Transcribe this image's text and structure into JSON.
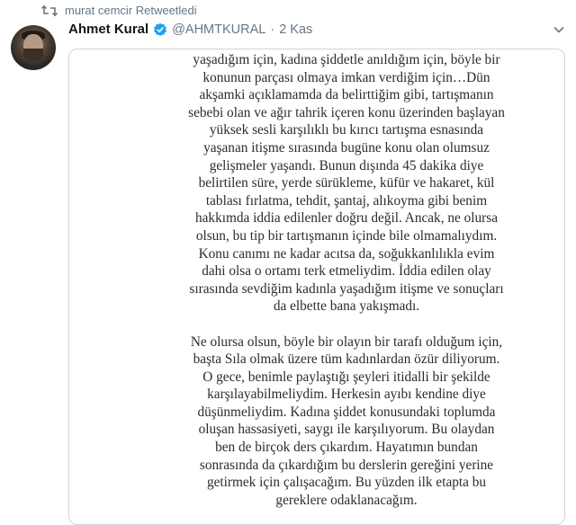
{
  "retweet": {
    "icon": "retweet-icon",
    "text": "murat cemcir Retweetledi"
  },
  "tweet": {
    "display_name": "Ahmet Kural",
    "verified_icon": "verified-badge-icon",
    "handle": "@AHMTKURAL",
    "separator": "·",
    "date": "2 Kas",
    "menu_icon": "chevron-down-icon",
    "accent_color": "#1da1f2"
  },
  "note": {
    "lines": [
      "yaşadığım için, kadına şiddetle anıldığım için, böyle bir",
      "konunun parçası olmaya imkan verdiğim için…Dün",
      "akşamki açıklamamda da belirttiğim gibi, tartışmanın",
      "sebebi olan ve ağır tahrik içeren konu üzerinden başlayan",
      "yüksek sesli karşılıklı bu kırıcı tartışma esnasında",
      "yaşanan itişme sırasında bugüne konu olan olumsuz",
      "gelişmeler yaşandı. Bunun dışında 45 dakika diye",
      "belirtilen süre, yerde sürükleme, küfür ve hakaret, kül",
      "tablası fırlatma, tehdit, şantaj, alıkoyma gibi benim",
      "hakkımda iddia edilenler doğru değil. Ancak, ne olursa",
      "olsun, bu tip bir tartışmanın içinde bile olmamalıydım.",
      "Konu canımı ne kadar acıtsa da, soğukkanlılıkla evim",
      "dahi olsa o ortamı terk etmeliydim. İddia edilen olay",
      "sırasında sevdiğim kadınla yaşadığım itişme ve sonuçları",
      "da elbette bana yakışmadı.",
      "",
      "Ne olursa olsun,  böyle bir olayın bir tarafı olduğum için,",
      "başta Sıla olmak üzere tüm kadınlardan özür diliyorum.",
      "O gece, benimle paylaştığı şeyleri itidalli bir şekilde",
      "karşılayabilmeliydim. Herkesin ayıbı kendine diye",
      "düşünmeliydim. Kadına şiddet konusundaki toplumda",
      "oluşan hassasiyeti, saygı ile karşılıyorum. Bu olaydan",
      "ben de birçok ders çıkardım. Hayatımın bundan",
      "sonrasında da çıkardığım bu derslerin gereğini yerine",
      "getirmek için çalışacağım. Bu yüzden ilk etapta bu",
      "gereklere odaklanacağım."
    ]
  }
}
